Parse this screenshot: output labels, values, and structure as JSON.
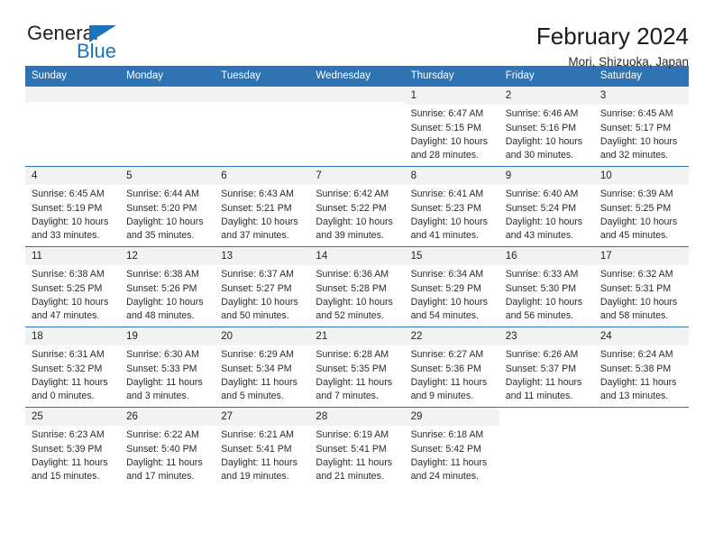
{
  "logo": {
    "word_one": "General",
    "word_two": "Blue",
    "triangle_color": "#1c75bc",
    "text_color": "#231f20"
  },
  "header": {
    "title": "February 2024",
    "subtitle": "Mori, Shizuoka, Japan"
  },
  "theme": {
    "header_blue": "#2e74b5",
    "daynum_band": "#f2f2f2",
    "text": "#222222"
  },
  "weekdays": [
    "Sunday",
    "Monday",
    "Tuesday",
    "Wednesday",
    "Thursday",
    "Friday",
    "Saturday"
  ],
  "labels": {
    "sunrise_prefix": "Sunrise:",
    "sunset_prefix": "Sunset:",
    "daylight_prefix": "Daylight:"
  },
  "weeks": [
    [
      {
        "day": "",
        "empty": true
      },
      {
        "day": "",
        "empty": true
      },
      {
        "day": "",
        "empty": true
      },
      {
        "day": "",
        "empty": true
      },
      {
        "day": "1",
        "sunrise": "Sunrise: 6:47 AM",
        "sunset": "Sunset: 5:15 PM",
        "daylight1": "Daylight: 10 hours",
        "daylight2": "and 28 minutes."
      },
      {
        "day": "2",
        "sunrise": "Sunrise: 6:46 AM",
        "sunset": "Sunset: 5:16 PM",
        "daylight1": "Daylight: 10 hours",
        "daylight2": "and 30 minutes."
      },
      {
        "day": "3",
        "sunrise": "Sunrise: 6:45 AM",
        "sunset": "Sunset: 5:17 PM",
        "daylight1": "Daylight: 10 hours",
        "daylight2": "and 32 minutes."
      }
    ],
    [
      {
        "day": "4",
        "sunrise": "Sunrise: 6:45 AM",
        "sunset": "Sunset: 5:19 PM",
        "daylight1": "Daylight: 10 hours",
        "daylight2": "and 33 minutes."
      },
      {
        "day": "5",
        "sunrise": "Sunrise: 6:44 AM",
        "sunset": "Sunset: 5:20 PM",
        "daylight1": "Daylight: 10 hours",
        "daylight2": "and 35 minutes."
      },
      {
        "day": "6",
        "sunrise": "Sunrise: 6:43 AM",
        "sunset": "Sunset: 5:21 PM",
        "daylight1": "Daylight: 10 hours",
        "daylight2": "and 37 minutes."
      },
      {
        "day": "7",
        "sunrise": "Sunrise: 6:42 AM",
        "sunset": "Sunset: 5:22 PM",
        "daylight1": "Daylight: 10 hours",
        "daylight2": "and 39 minutes."
      },
      {
        "day": "8",
        "sunrise": "Sunrise: 6:41 AM",
        "sunset": "Sunset: 5:23 PM",
        "daylight1": "Daylight: 10 hours",
        "daylight2": "and 41 minutes."
      },
      {
        "day": "9",
        "sunrise": "Sunrise: 6:40 AM",
        "sunset": "Sunset: 5:24 PM",
        "daylight1": "Daylight: 10 hours",
        "daylight2": "and 43 minutes."
      },
      {
        "day": "10",
        "sunrise": "Sunrise: 6:39 AM",
        "sunset": "Sunset: 5:25 PM",
        "daylight1": "Daylight: 10 hours",
        "daylight2": "and 45 minutes."
      }
    ],
    [
      {
        "day": "11",
        "sunrise": "Sunrise: 6:38 AM",
        "sunset": "Sunset: 5:25 PM",
        "daylight1": "Daylight: 10 hours",
        "daylight2": "and 47 minutes."
      },
      {
        "day": "12",
        "sunrise": "Sunrise: 6:38 AM",
        "sunset": "Sunset: 5:26 PM",
        "daylight1": "Daylight: 10 hours",
        "daylight2": "and 48 minutes."
      },
      {
        "day": "13",
        "sunrise": "Sunrise: 6:37 AM",
        "sunset": "Sunset: 5:27 PM",
        "daylight1": "Daylight: 10 hours",
        "daylight2": "and 50 minutes."
      },
      {
        "day": "14",
        "sunrise": "Sunrise: 6:36 AM",
        "sunset": "Sunset: 5:28 PM",
        "daylight1": "Daylight: 10 hours",
        "daylight2": "and 52 minutes."
      },
      {
        "day": "15",
        "sunrise": "Sunrise: 6:34 AM",
        "sunset": "Sunset: 5:29 PM",
        "daylight1": "Daylight: 10 hours",
        "daylight2": "and 54 minutes."
      },
      {
        "day": "16",
        "sunrise": "Sunrise: 6:33 AM",
        "sunset": "Sunset: 5:30 PM",
        "daylight1": "Daylight: 10 hours",
        "daylight2": "and 56 minutes."
      },
      {
        "day": "17",
        "sunrise": "Sunrise: 6:32 AM",
        "sunset": "Sunset: 5:31 PM",
        "daylight1": "Daylight: 10 hours",
        "daylight2": "and 58 minutes."
      }
    ],
    [
      {
        "day": "18",
        "sunrise": "Sunrise: 6:31 AM",
        "sunset": "Sunset: 5:32 PM",
        "daylight1": "Daylight: 11 hours",
        "daylight2": "and 0 minutes."
      },
      {
        "day": "19",
        "sunrise": "Sunrise: 6:30 AM",
        "sunset": "Sunset: 5:33 PM",
        "daylight1": "Daylight: 11 hours",
        "daylight2": "and 3 minutes."
      },
      {
        "day": "20",
        "sunrise": "Sunrise: 6:29 AM",
        "sunset": "Sunset: 5:34 PM",
        "daylight1": "Daylight: 11 hours",
        "daylight2": "and 5 minutes."
      },
      {
        "day": "21",
        "sunrise": "Sunrise: 6:28 AM",
        "sunset": "Sunset: 5:35 PM",
        "daylight1": "Daylight: 11 hours",
        "daylight2": "and 7 minutes."
      },
      {
        "day": "22",
        "sunrise": "Sunrise: 6:27 AM",
        "sunset": "Sunset: 5:36 PM",
        "daylight1": "Daylight: 11 hours",
        "daylight2": "and 9 minutes."
      },
      {
        "day": "23",
        "sunrise": "Sunrise: 6:26 AM",
        "sunset": "Sunset: 5:37 PM",
        "daylight1": "Daylight: 11 hours",
        "daylight2": "and 11 minutes."
      },
      {
        "day": "24",
        "sunrise": "Sunrise: 6:24 AM",
        "sunset": "Sunset: 5:38 PM",
        "daylight1": "Daylight: 11 hours",
        "daylight2": "and 13 minutes."
      }
    ],
    [
      {
        "day": "25",
        "sunrise": "Sunrise: 6:23 AM",
        "sunset": "Sunset: 5:39 PM",
        "daylight1": "Daylight: 11 hours",
        "daylight2": "and 15 minutes."
      },
      {
        "day": "26",
        "sunrise": "Sunrise: 6:22 AM",
        "sunset": "Sunset: 5:40 PM",
        "daylight1": "Daylight: 11 hours",
        "daylight2": "and 17 minutes."
      },
      {
        "day": "27",
        "sunrise": "Sunrise: 6:21 AM",
        "sunset": "Sunset: 5:41 PM",
        "daylight1": "Daylight: 11 hours",
        "daylight2": "and 19 minutes."
      },
      {
        "day": "28",
        "sunrise": "Sunrise: 6:19 AM",
        "sunset": "Sunset: 5:41 PM",
        "daylight1": "Daylight: 11 hours",
        "daylight2": "and 21 minutes."
      },
      {
        "day": "29",
        "sunrise": "Sunrise: 6:18 AM",
        "sunset": "Sunset: 5:42 PM",
        "daylight1": "Daylight: 11 hours",
        "daylight2": "and 24 minutes."
      },
      {
        "day": "",
        "empty": true,
        "blank": true
      },
      {
        "day": "",
        "empty": true,
        "blank": true
      }
    ]
  ]
}
